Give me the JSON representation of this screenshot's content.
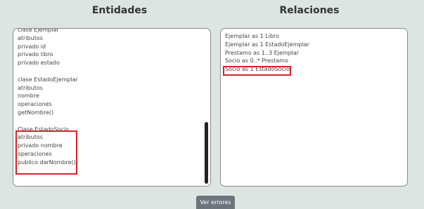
{
  "panels": {
    "entities_title": "Entidades",
    "relations_title": "Relaciones"
  },
  "entities": {
    "lines": [
      "clase Ejemplar",
      "atributos",
      "privado id",
      "privado libro",
      "privado estado",
      "",
      "clase EstadoEjemplar",
      "atributos",
      "nombre",
      "operaciones",
      "getNombre()",
      "",
      "Clase EstadoSocio",
      "atributos",
      "privado nombre",
      "operaciones",
      "publico darNombre()"
    ]
  },
  "relations": {
    "lines": [
      "Ejemplar as 1 Libro",
      "Ejemplar as 1 EstadoEjemplar",
      "Prestamo as 1..3 Ejemplar",
      "Socio as 0..* Prestamo",
      "Socio as 1 EstadoSocio"
    ]
  },
  "footer": {
    "button_label": "Ver errores"
  },
  "colors": {
    "background": "#dde5e2",
    "highlight": "#d8232a",
    "button": "#6c757d"
  }
}
